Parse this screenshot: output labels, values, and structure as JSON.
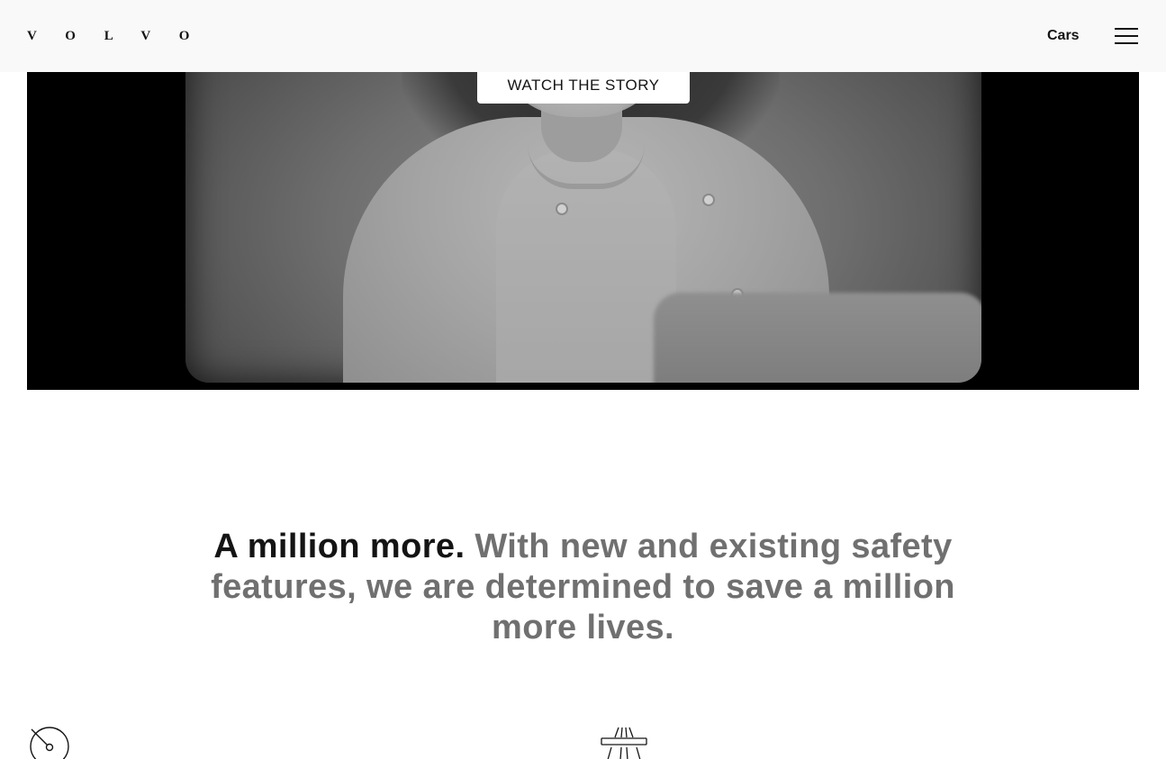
{
  "header": {
    "logo": "V O L V O",
    "nav_cars": "Cars",
    "menu_icon": "hamburger-menu-icon"
  },
  "video": {
    "button_label": "WATCH THE STORY"
  },
  "statement": {
    "lead": "A million more.",
    "rest": " With new and existing safety features, we are determined to save a million more lives."
  },
  "icons": {
    "left": "speedometer-icon",
    "right": "highway-road-icon"
  },
  "colors": {
    "header_bg": "#f9f9f9",
    "text_dark": "#141414",
    "text_grey": "#707070"
  }
}
